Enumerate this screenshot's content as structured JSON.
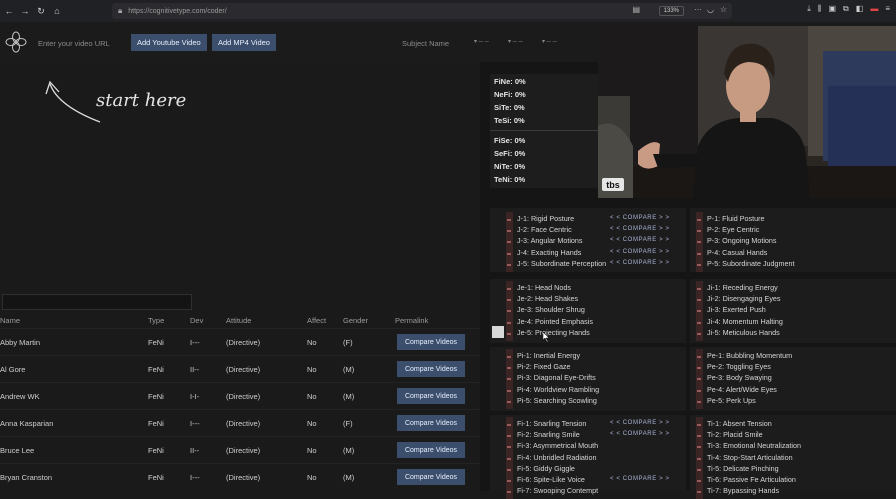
{
  "browser": {
    "url": "https://cognitivetype.com/coder/",
    "zoom": "133%"
  },
  "appbar": {
    "video_url_placeholder": "Enter your video URL",
    "add_youtube_label": "Add Youtube Video",
    "add_mp4_label": "Add MP4 Video",
    "subject_placeholder": "Subject Name"
  },
  "start_here": "start here",
  "table": {
    "headers": [
      "Name",
      "Type",
      "Dev",
      "Attitude",
      "Affect",
      "Gender",
      "Permalink"
    ],
    "compare_label": "Compare Videos",
    "rows": [
      {
        "name": "Abby Martin",
        "type": "FeNi",
        "dev": "I---",
        "attitude": "(Directive)",
        "affect": "No",
        "gender": "(F)"
      },
      {
        "name": "Al Gore",
        "type": "FeNi",
        "dev": "II--",
        "attitude": "(Directive)",
        "affect": "No",
        "gender": "(M)"
      },
      {
        "name": "Andrew WK",
        "type": "FeNi",
        "dev": "I-I-",
        "attitude": "(Directive)",
        "affect": "No",
        "gender": "(M)"
      },
      {
        "name": "Anna Kasparian",
        "type": "FeNi",
        "dev": "I---",
        "attitude": "(Directive)",
        "affect": "No",
        "gender": "(F)"
      },
      {
        "name": "Bruce Lee",
        "type": "FeNi",
        "dev": "II--",
        "attitude": "(Directive)",
        "affect": "No",
        "gender": "(M)"
      },
      {
        "name": "Bryan Cranston",
        "type": "FeNi",
        "dev": "I---",
        "attitude": "(Directive)",
        "affect": "No",
        "gender": "(M)"
      }
    ]
  },
  "stats": [
    {
      "label": "FiNe:",
      "value": "0%"
    },
    {
      "label": "NeFi:",
      "value": "0%"
    },
    {
      "label": "SiTe:",
      "value": "0%"
    },
    {
      "label": "TeSi:",
      "value": "0%"
    },
    {
      "label": "FiSe:",
      "value": "0%"
    },
    {
      "label": "SeFi:",
      "value": "0%"
    },
    {
      "label": "NiTe:",
      "value": "0%"
    },
    {
      "label": "TeNi:",
      "value": "0%"
    }
  ],
  "video": {
    "channel_logo": "tbs"
  },
  "compare_text": "< < COMPARE > >",
  "traits": {
    "j": [
      "J-1: Rigid Posture",
      "J-2: Face Centric",
      "J-3: Angular Motions",
      "J-4: Exacting Hands",
      "J-5: Subordinate Perception"
    ],
    "p": [
      "P-1: Fluid Posture",
      "P-2: Eye Centric",
      "P-3: Ongoing Motions",
      "P-4: Casual Hands",
      "P-5: Subordinate Judgment"
    ],
    "je": [
      "Je-1: Head Nods",
      "Je-2: Head Shakes",
      "Je-3: Shoulder Shrug",
      "Je-4: Pointed Emphasis",
      "Je-5: Projecting Hands"
    ],
    "ji": [
      "Ji-1: Receding Energy",
      "Ji-2: Disengaging Eyes",
      "Ji-3: Exerted Push",
      "Ji-4: Momentum Halting",
      "Ji-5: Meticulous Hands"
    ],
    "pi": [
      "Pi-1: Inertial Energy",
      "Pi-2: Fixed Gaze",
      "Pi-3: Diagonal Eye-Drifts",
      "Pi-4: Worldview Rambling",
      "Pi-5: Searching Scowling"
    ],
    "pe": [
      "Pe-1: Bubbling Momentum",
      "Pe-2: Toggling Eyes",
      "Pe-3: Body Swaying",
      "Pe-4: Alert/Wide Eyes",
      "Pe-5: Perk Ups"
    ],
    "fi": [
      "Fi-1: Snarling Tension",
      "Fi-2: Snarling Smile",
      "Fi-3: Asymmetrical Mouth",
      "Fi-4: Unbridled Radiation",
      "Fi-5: Giddy Giggle",
      "Fi-6: Spite-Like Voice",
      "Fi-7: Swooping Contempt"
    ],
    "ti": [
      "Ti-1: Absent Tension",
      "Ti-2: Placid Smile",
      "Ti-3: Emotional Neutralization",
      "Ti-4: Stop-Start Articulation",
      "Ti-5: Delicate Pinching",
      "Ti-6: Passive Fe Articulation",
      "Ti-7: Bypassing Hands"
    ]
  }
}
